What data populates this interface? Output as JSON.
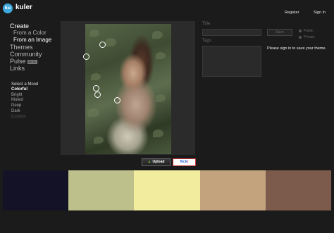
{
  "app": {
    "logo_mark": "ku",
    "name": "kuler"
  },
  "header": {
    "register": "Register",
    "signin": "Sign In"
  },
  "nav": {
    "create": "Create",
    "from_color": "From a Color",
    "from_image": "From an Image",
    "themes": "Themes",
    "community": "Community",
    "pulse": "Pulse",
    "beta": "BETA",
    "links": "Links"
  },
  "mood": {
    "heading": "Select a Mood",
    "options": [
      "Colorful",
      "Bright",
      "Muted",
      "Deep",
      "Dark",
      "Custom"
    ],
    "selected": "Colorful"
  },
  "image_actions": {
    "upload": "Upload",
    "flickr_a": "flick",
    "flickr_b": "r"
  },
  "form": {
    "title_label": "Title",
    "tags_label": "Tags",
    "save_label": "Save",
    "public_label": "Public",
    "private_label": "Private",
    "signin_msg": "Please sign in to save your theme."
  },
  "swatch_colors": [
    "#131226",
    "#bec08b",
    "#f2ec9f",
    "#c2a37d",
    "#7d5b4c"
  ]
}
